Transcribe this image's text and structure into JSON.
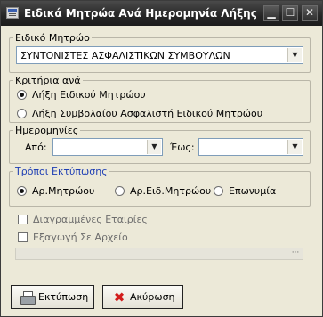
{
  "window": {
    "title": "Ειδικά Μητρώα Ανά Ημερομηνία Λήξης",
    "controls": {
      "minimize": "▁",
      "maximize": "☐",
      "close": "✕"
    }
  },
  "registry": {
    "label": "Ειδικό Μητρώο",
    "selected": "ΣΥΝΤΟΝΙΣΤΕΣ ΑΣΦΑΛΙΣΤΙΚΩΝ ΣΥΜΒΟΥΛΩΝ",
    "arrow": "▼"
  },
  "criteria": {
    "label": "Κριτήρια ανά",
    "options": [
      {
        "label": "Λήξη Ειδικού Μητρώου",
        "checked": true
      },
      {
        "label": "Λήξη Συμβολαίου Ασφαλιστή Ειδικού Μητρώου",
        "checked": false
      }
    ]
  },
  "dates": {
    "label": "Ημερομηνίες",
    "from_label": "Από:",
    "to_label": "Έως:",
    "from_value": "",
    "to_value": "",
    "arrow": "▼"
  },
  "print_modes": {
    "label": "Τρόποι Εκτύπωσης",
    "options": [
      {
        "label": "Αρ.Μητρώου",
        "checked": true
      },
      {
        "label": "Αρ.Ειδ.Μητρώου",
        "checked": false
      },
      {
        "label": "Επωνυμία",
        "checked": false
      }
    ]
  },
  "options": {
    "deleted_companies": "Διαγραμμένες Εταιρίες",
    "export_to_file": "Εξαγωγή Σε Αρχείο",
    "file_path": "",
    "browse": "···"
  },
  "buttons": {
    "print": "Εκτύπωση",
    "cancel": "Ακύρωση"
  },
  "colors": {
    "title_bar": "#262626",
    "window_bg": "#ece9d8",
    "group_accent": "#1f3fb4",
    "cancel_icon": "#d21d1d"
  },
  "icons": {
    "app": "app-icon",
    "print": "printer-icon",
    "cancel": "red-x-icon"
  }
}
